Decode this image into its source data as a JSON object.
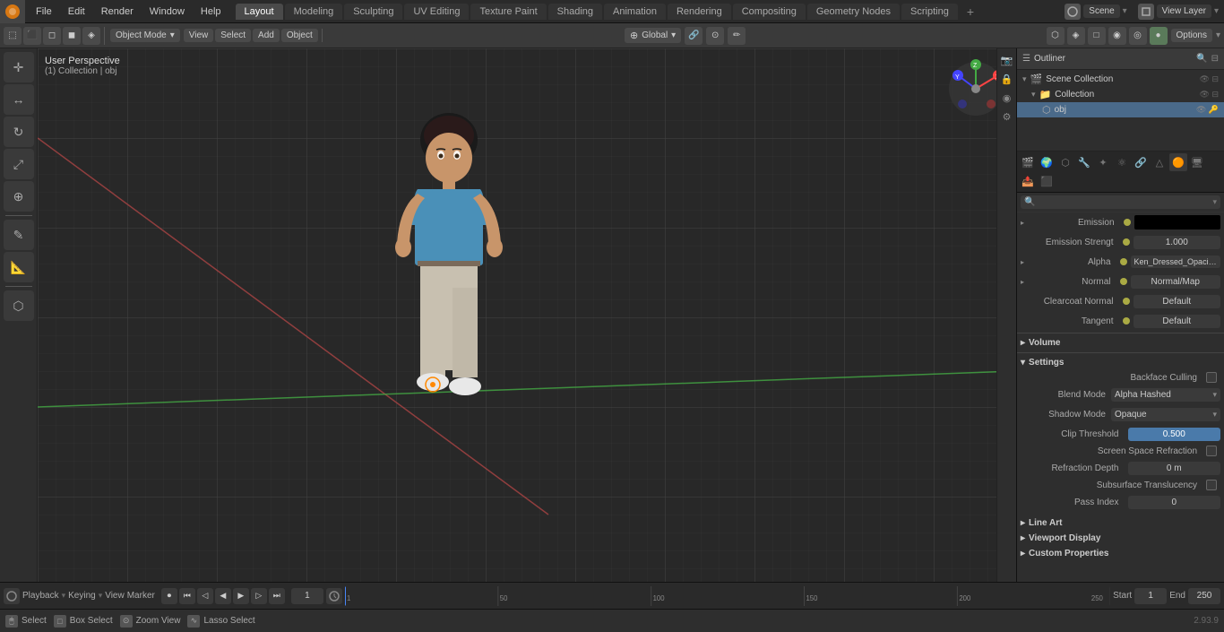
{
  "topMenu": {
    "logo": "●",
    "items": [
      "File",
      "Edit",
      "Render",
      "Window",
      "Help"
    ],
    "activeLayout": "Layout",
    "workspaceTabs": [
      "Layout",
      "Modeling",
      "Sculpting",
      "UV Editing",
      "Texture Paint",
      "Shading",
      "Animation",
      "Rendering",
      "Compositing",
      "Geometry Nodes",
      "Scripting"
    ],
    "activeTab": "Layout",
    "addTab": "+",
    "rightArea": {
      "sceneLabel": "Scene",
      "viewLayerLabel": "View Layer"
    }
  },
  "headerToolbar": {
    "objectMode": "Object Mode",
    "view": "View",
    "select": "Select",
    "add": "Add",
    "object": "Object",
    "transform": "Global",
    "options": "Options"
  },
  "viewport": {
    "label": "User Perspective",
    "sublabel": "(1) Collection | obj"
  },
  "leftTools": {
    "tools": [
      "⬚",
      "✛",
      "↻",
      "⊕",
      "⊗",
      "↕",
      "✎",
      "◻",
      "⊿"
    ]
  },
  "outliner": {
    "title": "Outliner",
    "items": [
      {
        "label": "Scene Collection",
        "icon": "▾",
        "indent": 0
      },
      {
        "label": "Collection",
        "icon": "▾",
        "indent": 1
      },
      {
        "label": "obj",
        "icon": "⬡",
        "indent": 2
      }
    ]
  },
  "properties": {
    "searchPlaceholder": "",
    "sections": {
      "emission": {
        "label": "Emission",
        "value": "",
        "colorValue": "#000000"
      },
      "emissionStrength": {
        "label": "Emission Strengt",
        "value": "1.000"
      },
      "alpha": {
        "label": "Alpha",
        "value": "Ken_Dressed_Opacit..."
      },
      "normal": {
        "label": "Normal",
        "value": "Normal/Map"
      },
      "clearcoatNormal": {
        "label": "Clearcoat Normal",
        "value": "Default"
      },
      "tangent": {
        "label": "Tangent",
        "value": "Default"
      },
      "volume": {
        "label": "Volume"
      },
      "settings": {
        "label": "Settings",
        "backfaceCulling": "Backface Culling",
        "blendMode": "Blend Mode",
        "blendModeValue": "Alpha Hashed",
        "shadowMode": "Shadow Mode",
        "shadowModeValue": "Opaque",
        "clipThreshold": "Clip Threshold",
        "clipThresholdValue": "0.500",
        "screenSpaceRefraction": "Screen Space Refraction",
        "refractionDepth": "Refraction Depth",
        "refractionDepthValue": "0 m",
        "subsurfaceTranslucency": "Subsurface Translucency",
        "passIndex": "Pass Index",
        "passIndexValue": "0"
      }
    }
  },
  "timeline": {
    "frame": "1",
    "start": "1",
    "end": "250",
    "playbackLabel": "Playback",
    "keyingLabel": "Keying",
    "view": "View",
    "marker": "Marker",
    "frameMarkers": [
      "1",
      "50",
      "100",
      "150",
      "200",
      "250"
    ]
  },
  "statusBar": {
    "select": "Select",
    "boxSelect": "Box Select",
    "zoomView": "Zoom View",
    "lassoSelect": "Lasso Select",
    "version": "2.93.9"
  }
}
